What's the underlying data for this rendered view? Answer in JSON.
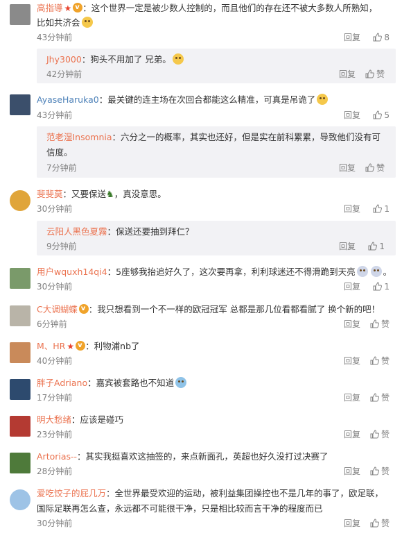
{
  "actions": {
    "reply": "回复",
    "like": "赞"
  },
  "comments": [
    {
      "name": "高指導",
      "text": "：这个世界一定是被少数人控制的，而且他们的存在还不被大多数人所熟知，",
      "text2": "比如共济会",
      "time": "43分钟前",
      "likes": "8",
      "replies": [
        {
          "name": "Jhy3000",
          "text": "：狗头不用加了 兄弟。",
          "time": "42分钟前",
          "likes": "赞"
        }
      ]
    },
    {
      "name": "AyaseHaruka0",
      "text": "：最关键的连主场在次回合都能这么精准，可真是吊诡了",
      "time": "43分钟前",
      "likes": "5",
      "replies": [
        {
          "name": "范老湿Insomnia",
          "text": "：六分之一的概率，其实也还好，但是实在前科累累，导致他们没有可",
          "text2": "信度。",
          "time": "7分钟前",
          "likes": "赞"
        }
      ]
    },
    {
      "name": "斐斐莫",
      "text": "：又要保送",
      "text3": "，真没意思。",
      "time": "30分钟前",
      "likes": "1",
      "replies": [
        {
          "name": "云阳人黑色夏霧",
          "text": "：保送还要抽到拜仁？",
          "time": "9分钟前",
          "likes": "1"
        }
      ]
    },
    {
      "name": "用户wquxh14qi4",
      "text": "：5座够我抬追好久了，这次要再拿，利利球迷还不得滑跪到天亮",
      "time": "30分钟前",
      "likes": "1"
    },
    {
      "name": "C大调蝴蝶",
      "text": "：我只想看到一个不一样的欧冠冠军 总都是那几位看都看腻了 换个新的吧！",
      "time": "6分钟前",
      "likes": "赞"
    },
    {
      "name": "M、HR",
      "text": "：利物浦nb了",
      "time": "40分钟前",
      "likes": "赞"
    },
    {
      "name": "胖子Adriano",
      "text": "：嘉宾被套路也不知道",
      "time": "17分钟前",
      "likes": "赞"
    },
    {
      "name": "明大愁绪",
      "text": "：应该是碰巧",
      "time": "23分钟前",
      "likes": "赞"
    },
    {
      "name": "Artorias--",
      "text": "：其实我挺喜欢这抽签的，来点新面孔，英超也好久没打过决赛了",
      "time": "28分钟前",
      "likes": "赞"
    },
    {
      "name": "爱吃饺子的屁几万",
      "text": "：全世界最受欢迎的运动，被利益集团操控也不是几年的事了，欧足联，",
      "text2": "国际足联再怎么查，永远都不可能很干净，只是相比较而言干净的程度而已",
      "time": "30分钟前",
      "likes": "赞"
    }
  ],
  "colors": {
    "name": "#eb7350",
    "sub_bg": "#f2f2f5",
    "meta": "#808080"
  }
}
